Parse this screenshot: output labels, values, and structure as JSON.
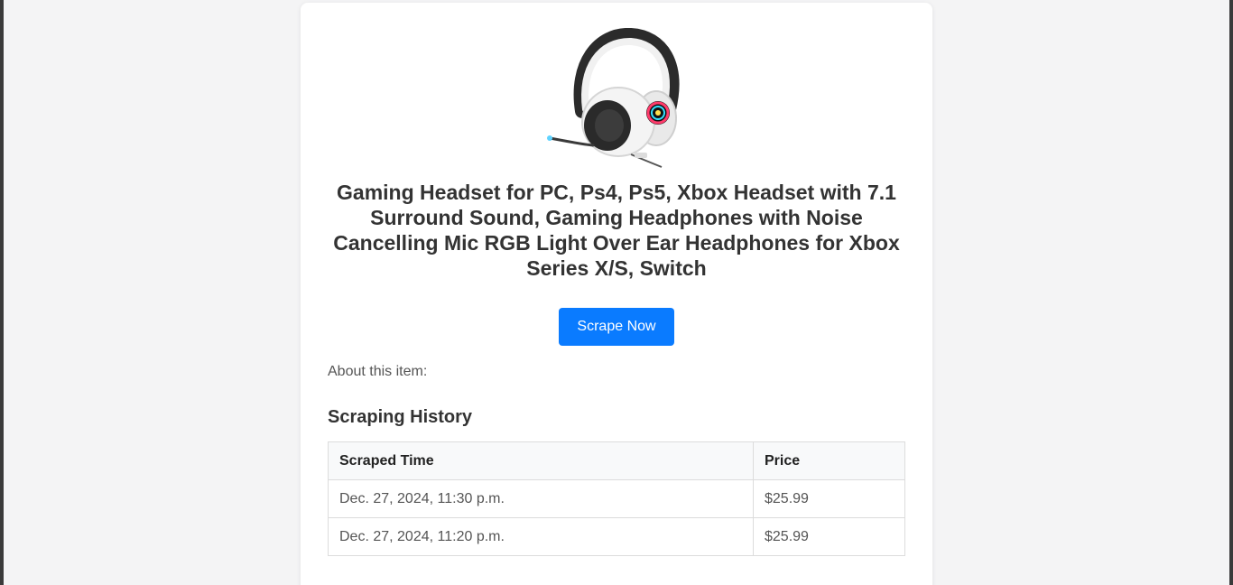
{
  "product": {
    "image_alt": "Gaming Headset",
    "title": "Gaming Headset for PC, Ps4, Ps5, Xbox Headset with 7.1 Surround Sound, Gaming Headphones with Noise Cancelling Mic RGB Light Over Ear Headphones for Xbox Series X/S, Switch",
    "scrape_button_label": "Scrape Now",
    "about_label": "About this item:"
  },
  "history": {
    "heading": "Scraping History",
    "columns": [
      "Scraped Time",
      "Price"
    ],
    "rows": [
      {
        "time": "Dec. 27, 2024, 11:30 p.m.",
        "price": "$25.99"
      },
      {
        "time": "Dec. 27, 2024, 11:20 p.m.",
        "price": "$25.99"
      }
    ]
  },
  "colors": {
    "accent": "#0a7bff",
    "page_background": "#f4f4f5",
    "card_background": "#ffffff"
  }
}
